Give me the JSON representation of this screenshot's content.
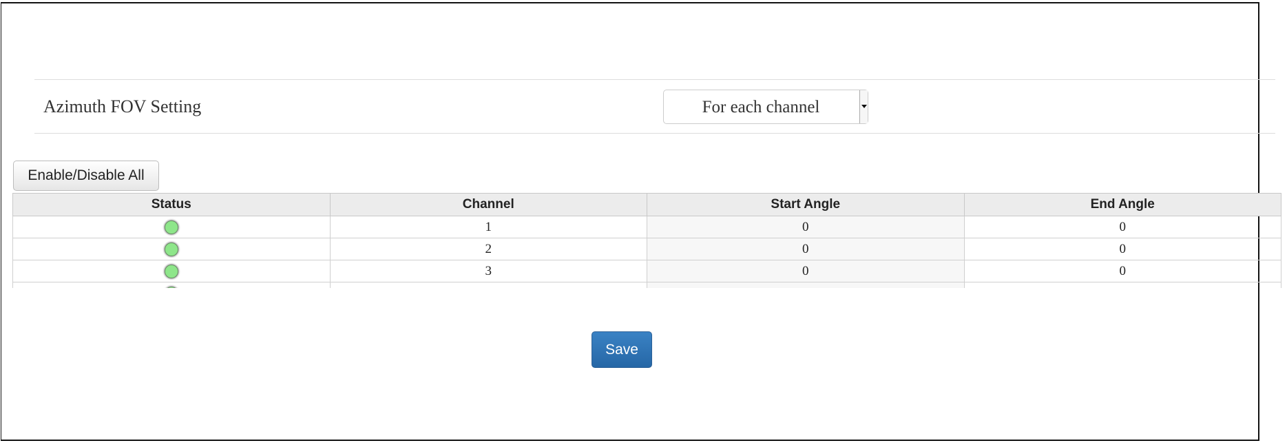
{
  "setting": {
    "label": "Azimuth FOV Setting",
    "select_value": "For each channel"
  },
  "toolbar": {
    "toggle_all_label": "Enable/Disable All"
  },
  "table": {
    "headers": [
      "Status",
      "Channel",
      "Start Angle",
      "End Angle"
    ],
    "rows": [
      {
        "status": "enabled",
        "channel": "1",
        "start": "0",
        "end": "0"
      },
      {
        "status": "enabled",
        "channel": "2",
        "start": "0",
        "end": "0"
      },
      {
        "status": "enabled",
        "channel": "3",
        "start": "0",
        "end": "0"
      },
      {
        "status": "enabled",
        "channel": "",
        "start": "",
        "end": ""
      }
    ]
  },
  "footer": {
    "save_label": "Save"
  },
  "colors": {
    "status_enabled": "#8ee68a",
    "save_button": "#2f74b5"
  }
}
